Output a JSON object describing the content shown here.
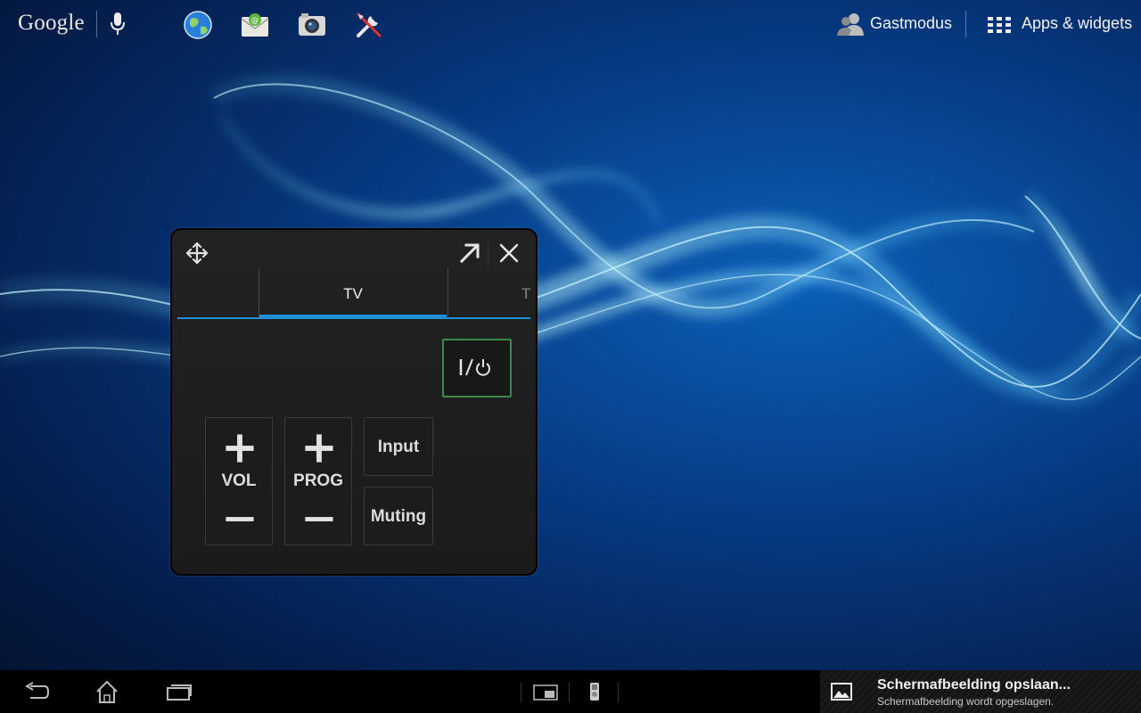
{
  "topbar": {
    "search_logo": "Google",
    "voice_search_icon": "microphone-icon",
    "shortcuts": [
      "browser-globe-icon",
      "email-icon",
      "camera-icon",
      "settings-tools-icon"
    ],
    "guest_mode_label": "Gastmodus",
    "apps_widgets_label": "Apps & widgets"
  },
  "remote_widget": {
    "tabs": [
      "",
      "TV",
      "T"
    ],
    "active_tab": "TV",
    "power_label": "I/⏻",
    "vol_label": "VOL",
    "prog_label": "PROG",
    "input_label": "Input",
    "muting_label": "Muting",
    "accent_color": "#1c8fd6"
  },
  "navbar": {
    "icons": [
      "back-icon",
      "home-icon",
      "recent-apps-icon",
      "small-app-icon",
      "usb-icon"
    ]
  },
  "notification": {
    "title": "Schermafbeelding opslaan...",
    "subtitle": "Schermafbeelding wordt opgeslagen."
  }
}
